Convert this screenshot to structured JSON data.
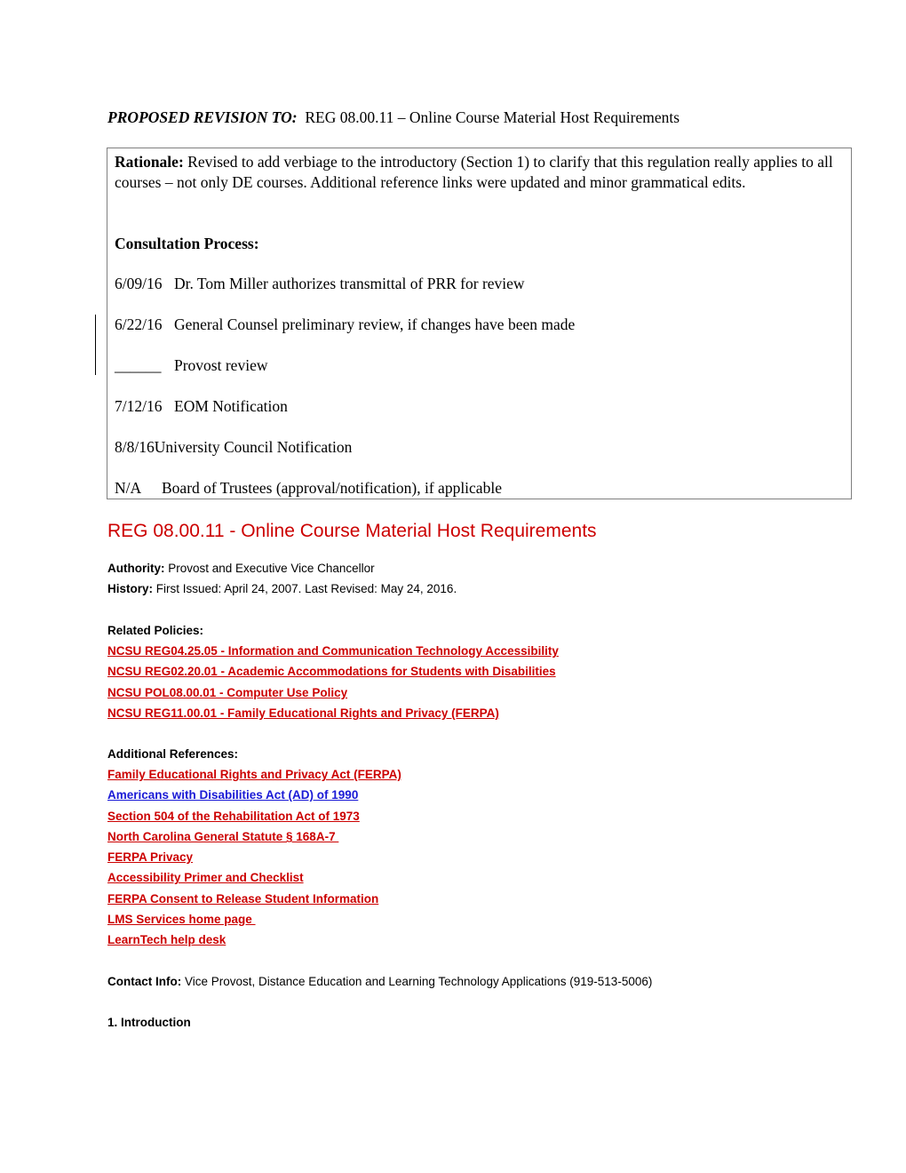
{
  "header": {
    "label": "PROPOSED REVISION TO:",
    "text": "REG 08.00.11 – Online Course Material Host Requirements"
  },
  "rationale_box": {
    "rationale_label": "Rationale:",
    "rationale_text": " Revised to add verbiage to the introductory (Section 1) to clarify that this regulation really applies to all courses – not only DE courses. Additional reference links were updated and minor grammatical edits.",
    "consultation_heading": "Consultation Process:",
    "steps": [
      {
        "date": "6/09/16",
        "text": "Dr. Tom Miller authorizes transmittal of PRR for review"
      },
      {
        "date": "6/22/16",
        "text": "General Counsel preliminary review, if changes have been made"
      },
      {
        "date": "______",
        "text": "Provost review"
      },
      {
        "date": "7/12/16",
        "text": "EOM Notification"
      },
      {
        "date": "8/8/16",
        "text": "University Council Notification"
      },
      {
        "date": "N/A",
        "text": "Board of Trustees (approval/notification), if applicable"
      }
    ]
  },
  "regulation": {
    "title": "REG 08.00.11 - Online Course Material Host Requirements",
    "title_color": "#cc0000",
    "authority_label": "Authority:",
    "authority_value": " Provost and Executive Vice Chancellor",
    "history_label": "History:",
    "history_value": " First Issued: April 24, 2007. Last Revised: May 24, 2016.",
    "related_policies_heading": "Related Policies:",
    "related_policies": [
      "NCSU REG04.25.05 - Information and Communication Technology Accessibility",
      "NCSU REG02.20.01 - Academic Accommodations for Students with Disabilities",
      "NCSU POL08.00.01 - Computer Use Policy",
      "NCSU REG11.00.01 - Family Educational Rights and Privacy (FERPA)"
    ],
    "additional_references_heading": "Additional References:",
    "additional_references": [
      "Family Educational Rights and Privacy Act (FERPA)",
      "Americans with Disabilities Act (AD) of 1990",
      "Section 504 of the Rehabilitation Act of 1973",
      "North Carolina General Statute § 168A-7 ",
      "FERPA Privacy",
      "Accessibility Primer and Checklist",
      "FERPA Consent to Release Student Information",
      "LMS Services home page ",
      "LearnTech help desk"
    ],
    "contact_label": "Contact Info:",
    "contact_value": " Vice Provost, Distance Education and Learning Technology Applications (919-513-5006)",
    "section_1_heading": "1. Introduction"
  },
  "link_colors": {
    "default": "#cc0000",
    "visited": "#1a1ad6"
  }
}
